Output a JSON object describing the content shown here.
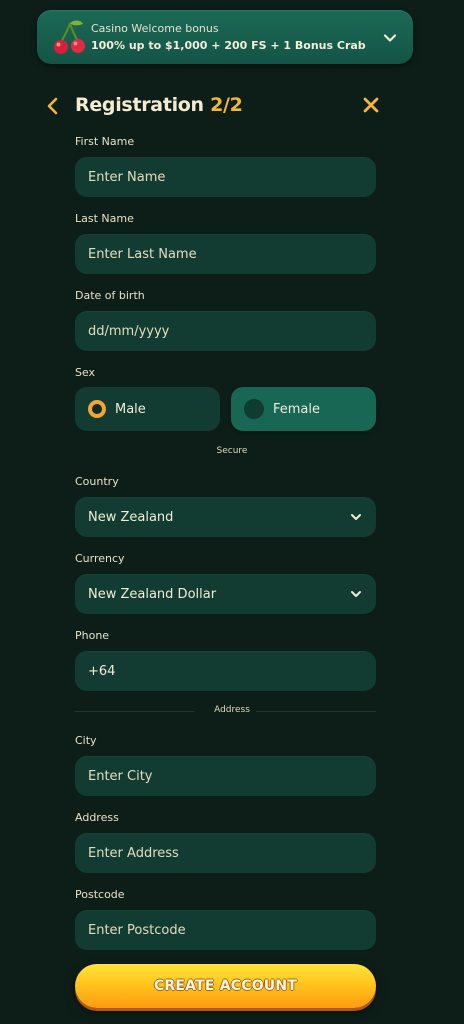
{
  "bonus": {
    "title": "Casino Welcome bonus",
    "offer": "100% up to $1,000 + 200 FS + 1 Bonus Crab"
  },
  "header": {
    "title_text": "Registration ",
    "title_step": "2/2"
  },
  "form": {
    "first_name": {
      "label": "First Name",
      "placeholder": "Enter Name"
    },
    "last_name": {
      "label": "Last Name",
      "placeholder": "Enter Last Name"
    },
    "dob": {
      "label": "Date of birth",
      "placeholder": "dd/mm/yyyy"
    },
    "sex": {
      "label": "Sex",
      "male": "Male",
      "female": "Female",
      "selected": "Male"
    },
    "secure_divider": "Secure",
    "country": {
      "label": "Country",
      "value": "New Zealand"
    },
    "currency": {
      "label": "Currency",
      "value": "New Zealand Dollar"
    },
    "phone": {
      "label": "Phone",
      "value": "+64"
    },
    "address_divider": "Address",
    "city": {
      "label": "City",
      "placeholder": "Enter City"
    },
    "address": {
      "label": "Address",
      "placeholder": "Enter Address"
    },
    "postcode": {
      "label": "Postcode",
      "placeholder": "Enter Postcode"
    }
  },
  "cta": {
    "label": "CREATE ACCOUNT"
  },
  "colors": {
    "background": "#0d1e19",
    "field": "#123c31",
    "accent": "#f4b634",
    "cta_top": "#ffe43a",
    "cta_bottom": "#ff9a12"
  },
  "icons": {
    "bonus": "cherry-icon",
    "expand": "chevron-down-icon",
    "back": "chevron-left-icon",
    "close": "close-icon"
  }
}
